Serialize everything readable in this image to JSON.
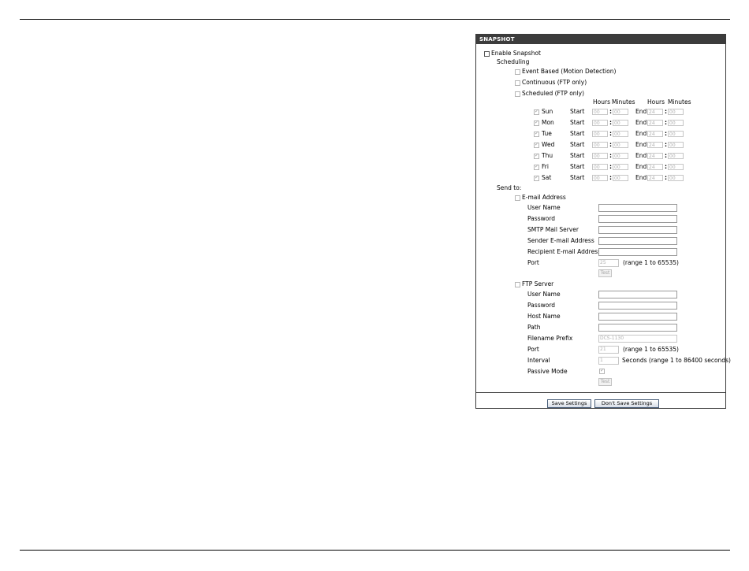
{
  "panel": {
    "title": "SNAPSHOT",
    "enable_snapshot": "Enable Snapshot",
    "scheduling": "Scheduling",
    "schedule_options": [
      "Event Based (Motion Detection)",
      "Continuous (FTP only)",
      "Scheduled (FTP only)"
    ],
    "headers": {
      "hours": "Hours",
      "minutes": "Minutes"
    },
    "start_label": "Start",
    "end_label": "End",
    "days": [
      {
        "day": "Sun",
        "checked": true,
        "start_h": "00",
        "start_m": "00",
        "end_h": "24",
        "end_m": "00"
      },
      {
        "day": "Mon",
        "checked": true,
        "start_h": "00",
        "start_m": "00",
        "end_h": "24",
        "end_m": "00"
      },
      {
        "day": "Tue",
        "checked": true,
        "start_h": "00",
        "start_m": "00",
        "end_h": "24",
        "end_m": "00"
      },
      {
        "day": "Wed",
        "checked": true,
        "start_h": "00",
        "start_m": "00",
        "end_h": "24",
        "end_m": "00"
      },
      {
        "day": "Thu",
        "checked": true,
        "start_h": "00",
        "start_m": "00",
        "end_h": "24",
        "end_m": "00"
      },
      {
        "day": "Fri",
        "checked": true,
        "start_h": "00",
        "start_m": "00",
        "end_h": "24",
        "end_m": "00"
      },
      {
        "day": "Sat",
        "checked": true,
        "start_h": "00",
        "start_m": "00",
        "end_h": "24",
        "end_m": "00"
      }
    ],
    "send_to": "Send to:",
    "email": {
      "label": "E-mail Address",
      "user_name": "User Name",
      "password": "Password",
      "smtp": "SMTP Mail Server",
      "sender": "Sender E-mail Address",
      "recipient": "Recipient E-mail Address",
      "port": "Port",
      "port_value": "25",
      "port_range": "(range 1 to 65535)",
      "test": "Test"
    },
    "ftp": {
      "label": "FTP Server",
      "user_name": "User Name",
      "password": "Password",
      "host_name": "Host Name",
      "path": "Path",
      "filename_prefix": "Filename Prefix",
      "filename_prefix_value": "DCS-1130",
      "port": "Port",
      "port_value": "21",
      "port_range": "(range 1 to 65535)",
      "interval": "Interval",
      "interval_value": "1",
      "interval_note": "Seconds  (range 1 to 86400 seconds)",
      "passive_mode": "Passive Mode",
      "passive_checked": true,
      "test": "Test"
    },
    "buttons": {
      "save": "Save Settings",
      "dont_save": "Don't Save Settings"
    }
  }
}
